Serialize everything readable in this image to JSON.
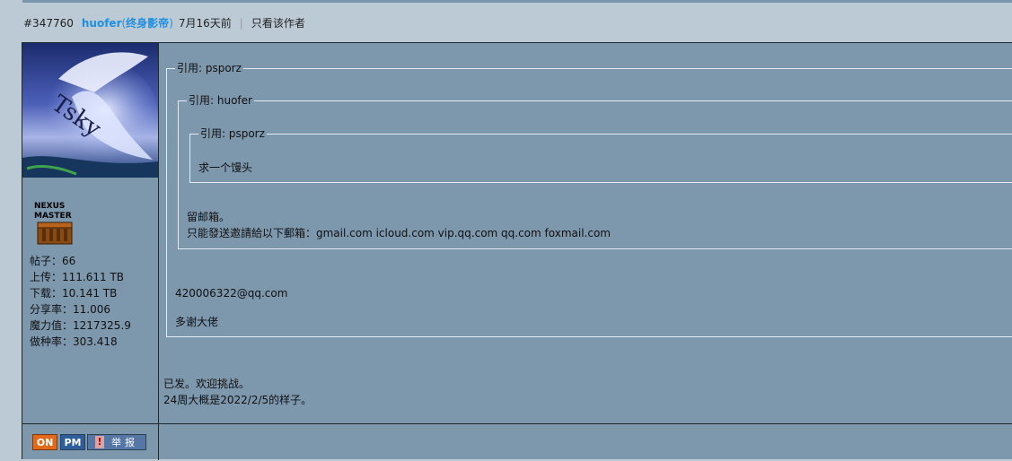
{
  "post": {
    "id": "#347760",
    "author": "huofer",
    "paren_open": "(",
    "title": "终身影帝",
    "paren_close": ")",
    "time": "7月16天前",
    "separator": "|",
    "only_author": "只看该作者"
  },
  "user": {
    "avatar_signature": "Tsky",
    "level_badge": "NEXUS MASTER",
    "stats": [
      "帖子：66",
      "上传：111.611 TB",
      "下载：10.141 TB",
      "分享率：11.006",
      "魔力值：1217325.9",
      "做种率：303.418"
    ]
  },
  "quotes": {
    "outer_label": "引用: psporz",
    "middle_label": "引用: huofer",
    "inner_label": "引用: psporz",
    "inner_text": "求一个馒头",
    "middle_text_1": "留邮箱。",
    "middle_text_2": "只能發送邀請給以下郵箱：gmail.com icloud.com vip.qq.com qq.com foxmail.com",
    "outer_text_1": "420006322@qq.com",
    "outer_text_2": "多谢大佬"
  },
  "body": {
    "line1": "已发。欢迎挑战。",
    "line2": "24周大概是2022/2/5的样子。"
  },
  "actions": {
    "online": "ON",
    "pm": "PM",
    "report_mark": "!",
    "report": "举报"
  },
  "colors": {
    "page_bg": "#bccad6",
    "post_bg": "#7d97ad",
    "author": "#1f8fe0",
    "online_button": "#e06a1a"
  }
}
